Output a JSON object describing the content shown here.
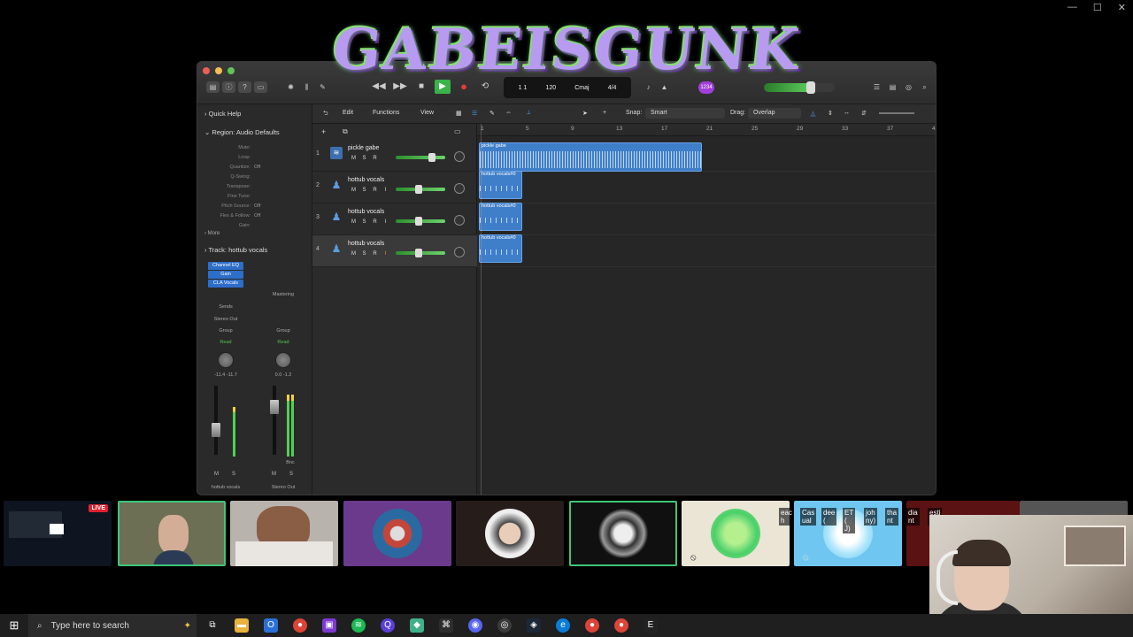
{
  "banner": {
    "text": "GABEISGUNK"
  },
  "window_controls": [
    "—",
    "☐",
    "✕"
  ],
  "logic": {
    "lcd": {
      "bar": "1  1",
      "tempo": "120",
      "key": "Cmaj",
      "sig": "4/4"
    },
    "badge": "1234",
    "toolbar_menus": {
      "edit": "Edit",
      "functions": "Functions",
      "view": "View"
    },
    "snap_label": "Snap:",
    "snap_value": "Smart",
    "drag_label": "Drag:",
    "drag_value": "Overlap",
    "inspector": {
      "quick_help": "Quick Help",
      "region_label": "Region:",
      "region_value": "Audio Defaults",
      "params": [
        {
          "k": "Mute:",
          "v": ""
        },
        {
          "k": "Loop:",
          "v": ""
        },
        {
          "k": "Quantize:",
          "v": "Off"
        },
        {
          "k": "Q-Swing:",
          "v": ""
        },
        {
          "k": "Transpose:",
          "v": ""
        },
        {
          "k": "Fine Tune:",
          "v": ""
        },
        {
          "k": "Pitch Source:",
          "v": "Off"
        },
        {
          "k": "Flex & Follow:",
          "v": "Off"
        },
        {
          "k": "Gain:",
          "v": ""
        }
      ],
      "more": "More",
      "track_label": "Track:",
      "track_value": "hottub vocals",
      "plugins": [
        "Channel EQ",
        "Gain",
        "CLA Vocals"
      ],
      "mastering": "Mastering",
      "sends": "Sends",
      "stereo_out": "Stereo Out",
      "group": "Group",
      "read": "Read",
      "left_db": [
        "-11.4",
        "-11.7"
      ],
      "right_db": [
        "0.0",
        "-1.2"
      ],
      "bnc": "Bnc",
      "m": "M",
      "s": "S",
      "strip_left_name": "hottub vocals",
      "strip_right_name": "Stereo Out"
    },
    "ruler": [
      "1",
      "5",
      "9",
      "13",
      "17",
      "21",
      "25",
      "29",
      "33",
      "37",
      "41"
    ],
    "tracks": [
      {
        "num": "1",
        "name": "pickle gabe",
        "btns": [
          "M",
          "S",
          "R"
        ],
        "vol": 0.78
      },
      {
        "num": "2",
        "name": "hottub vocals",
        "btns": [
          "M",
          "S",
          "R",
          "I"
        ],
        "vol": 0.45
      },
      {
        "num": "3",
        "name": "hottub vocals",
        "btns": [
          "M",
          "S",
          "R",
          "I"
        ],
        "vol": 0.45
      },
      {
        "num": "4",
        "name": "hottub vocals",
        "btns": [
          "M",
          "S",
          "R",
          "I"
        ],
        "vol": 0.45
      }
    ],
    "regions": [
      "pickle gabe",
      "hottub vocals#0",
      "hottub vocals#0",
      "hottub vocals#0"
    ]
  },
  "tiles": {
    "live": "LIVE",
    "caption_words": [
      "eac h",
      "Cas ual",
      "dee (",
      "ET ( J)",
      "joh ny)",
      "tha nt",
      "dia nt",
      "esti ny)"
    ]
  },
  "taskbar": {
    "search_placeholder": "Type here to search"
  }
}
